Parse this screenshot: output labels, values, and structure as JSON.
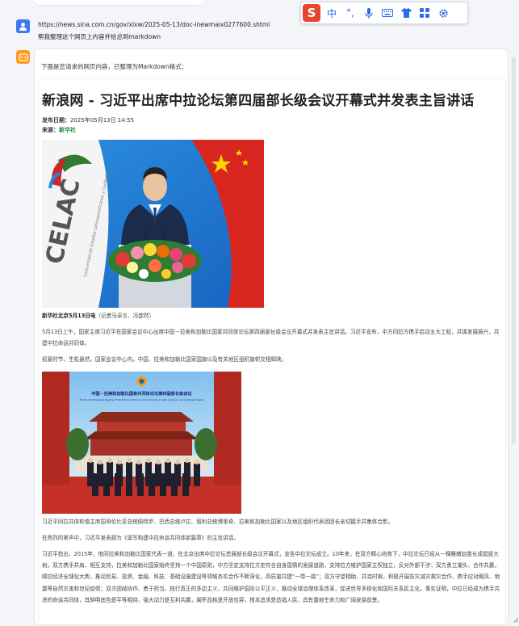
{
  "ime": {
    "logo": "S",
    "mode": "中",
    "punct": "°,"
  },
  "user": {
    "url": "https://news.sina.com.cn/gov/xlxw/2025-05-13/doc-inewmaix0277600.shtml",
    "request": "帮我整理这个网页上内容并给总到markdown"
  },
  "bot": {
    "intro": "下面是您请求的网页内容，已整理为Markdown格式："
  },
  "article": {
    "title": "新浪网 - 习近平出席中拉论坛第四届部长级会议开幕式并发表主旨讲话",
    "date_label": "发布日期：",
    "date": "2025年05月13日 14:55",
    "source_label": "来源：",
    "source": "新华社",
    "caption_bold": "新华社北京5月13日电",
    "caption_rest": "（记者马卓言、冯歆然）",
    "p1": "5月13日上午，国家主席习近平在国家会议中心出席中国－拉美和加勒比国家共同体论坛第四届部长级会议开幕式并发表主旨讲话。习近平宣布，中方同拉方携手启动五大工程，共谋发展振兴，共建中拉命运共同体。",
    "p2": "初夏时节，生机盎然。国家会议中心内，中国、拉美和加勒比国家国旗以及有关地区组织旗帜交相辉映。",
    "img2_banner": "中国－拉美和加勒比国家共同体论坛第四届部长级会议",
    "img2_banner_en": "The Fourth Ministerial Meeting of the Forum of China and Community of Latin American and Caribbean States",
    "p3": "习近平同拉共体轮值主席国哥伦比亚总统佩特罗、巴西总统卢拉、智利总统博里奇、拉美和加勒比国家以及地区组织代表团团长亲切握手并集体合影。",
    "p4": "在热烈的掌声中，习近平发表题为《谱写构建中拉命运共同体新篇章》的主旨讲话。",
    "p5": "习近平指出，2015年，他同拉美和加勒比国家代表一道，在北京出席中拉论坛首届部长级会议开幕式，宣告中拉论坛成立。10年来，在双方精心培育下，中拉论坛已经从一棵稚嫩幼苗长成挺拔大树。双方携手并肩、相互支持，拉美和加勒比国家始终坚持一个中国原则，中方坚定支持拉方走符合自身国情的发展道路，支持拉方维护国家主权独立，反对外部干涉；双方勇立潮头、合作共赢，顺应经济全球化大势，推动贸易、投资、金融、科技、基础设施建设等领域务实合作不断深化，高质量共建“一带一路”；双方守望相助、共克时艰，积极开展防灾减灾救灾合作，携手应对飓风、地震等自然灾害和世纪疫情；双方团结协作、勇于担当，践行真正的多边主义，共同维护国际公平正义，推动全球治理体系改革，促进世界多极化和国际关系民主化。事实证明，中拉已经成为携手共进的命运共同体，其鲜明底色是平等相待，强大动力是互利共赢，闽怀品格是开放包容，根本追求是造福人民，具有蓬勃生命力和广阔发展前景。"
  },
  "img1_text": {
    "celac": "CELAC",
    "sub": "Comunidad de Estados Latinoamericanos y Caribeños"
  },
  "colors": {
    "accent_blue": "#3c78f0",
    "bot_orange": "#ff9a1f",
    "sougou_red": "#e8452e",
    "source_green": "#1a8a3a"
  }
}
